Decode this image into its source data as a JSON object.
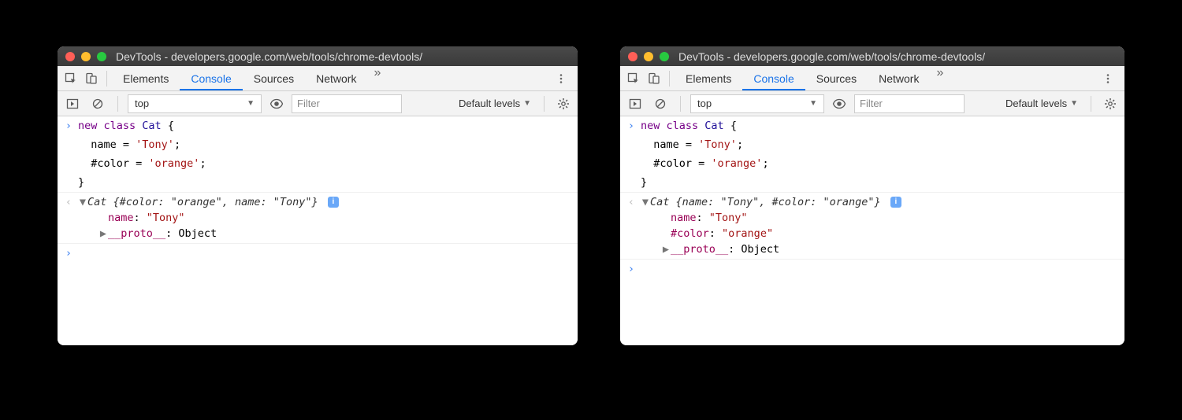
{
  "windows": [
    {
      "pos": "left",
      "title": "DevTools - developers.google.com/web/tools/chrome-devtools/",
      "tabs": [
        "Elements",
        "Console",
        "Sources",
        "Network"
      ],
      "active_tab": "Console",
      "context": "top",
      "filter_placeholder": "Filter",
      "levels": "Default levels",
      "input_lines": [
        [
          {
            "t": "new ",
            "c": "kw"
          },
          {
            "t": "class ",
            "c": "kw"
          },
          {
            "t": "Cat",
            "c": "cls"
          },
          {
            "t": " {",
            "c": ""
          }
        ],
        [
          {
            "t": "  name = ",
            "c": ""
          },
          {
            "t": "'Tony'",
            "c": "str"
          },
          {
            "t": ";",
            "c": ""
          }
        ],
        [
          {
            "t": "  #color = ",
            "c": ""
          },
          {
            "t": "'orange'",
            "c": "str"
          },
          {
            "t": ";",
            "c": ""
          }
        ],
        [
          {
            "t": "}",
            "c": ""
          }
        ]
      ],
      "output": {
        "summary": [
          {
            "t": "Cat ",
            "c": "ital"
          },
          {
            "t": "{",
            "c": "ital"
          },
          {
            "t": "#color: ",
            "c": "ital prop"
          },
          {
            "t": "\"orange\"",
            "c": "ital str"
          },
          {
            "t": ", ",
            "c": "ital"
          },
          {
            "t": "name: ",
            "c": "ital prop"
          },
          {
            "t": "\"Tony\"",
            "c": "ital str"
          },
          {
            "t": "}",
            "c": "ital"
          }
        ],
        "props": [
          [
            {
              "t": "name",
              "c": "prop"
            },
            {
              "t": ": ",
              "c": ""
            },
            {
              "t": "\"Tony\"",
              "c": "str"
            }
          ],
          [
            {
              "t": "__proto__",
              "c": "prop"
            },
            {
              "t": ": Object",
              "c": ""
            }
          ]
        ],
        "proto_expandable": true
      }
    },
    {
      "pos": "right",
      "title": "DevTools - developers.google.com/web/tools/chrome-devtools/",
      "tabs": [
        "Elements",
        "Console",
        "Sources",
        "Network"
      ],
      "active_tab": "Console",
      "context": "top",
      "filter_placeholder": "Filter",
      "levels": "Default levels",
      "input_lines": [
        [
          {
            "t": "new ",
            "c": "kw"
          },
          {
            "t": "class ",
            "c": "kw"
          },
          {
            "t": "Cat",
            "c": "cls"
          },
          {
            "t": " {",
            "c": ""
          }
        ],
        [
          {
            "t": "  name = ",
            "c": ""
          },
          {
            "t": "'Tony'",
            "c": "str"
          },
          {
            "t": ";",
            "c": ""
          }
        ],
        [
          {
            "t": "  #color = ",
            "c": ""
          },
          {
            "t": "'orange'",
            "c": "str"
          },
          {
            "t": ";",
            "c": ""
          }
        ],
        [
          {
            "t": "}",
            "c": ""
          }
        ]
      ],
      "output": {
        "summary": [
          {
            "t": "Cat ",
            "c": "ital"
          },
          {
            "t": "{",
            "c": "ital"
          },
          {
            "t": "name: ",
            "c": "ital prop"
          },
          {
            "t": "\"Tony\"",
            "c": "ital str"
          },
          {
            "t": ", ",
            "c": "ital"
          },
          {
            "t": "#color: ",
            "c": "ital prop"
          },
          {
            "t": "\"orange\"",
            "c": "ital str"
          },
          {
            "t": "}",
            "c": "ital"
          }
        ],
        "props": [
          [
            {
              "t": "name",
              "c": "prop"
            },
            {
              "t": ": ",
              "c": ""
            },
            {
              "t": "\"Tony\"",
              "c": "str"
            }
          ],
          [
            {
              "t": "#color",
              "c": "prop"
            },
            {
              "t": ": ",
              "c": ""
            },
            {
              "t": "\"orange\"",
              "c": "str"
            }
          ],
          [
            {
              "t": "__proto__",
              "c": "prop"
            },
            {
              "t": ": Object",
              "c": ""
            }
          ]
        ],
        "proto_expandable": true
      }
    }
  ]
}
